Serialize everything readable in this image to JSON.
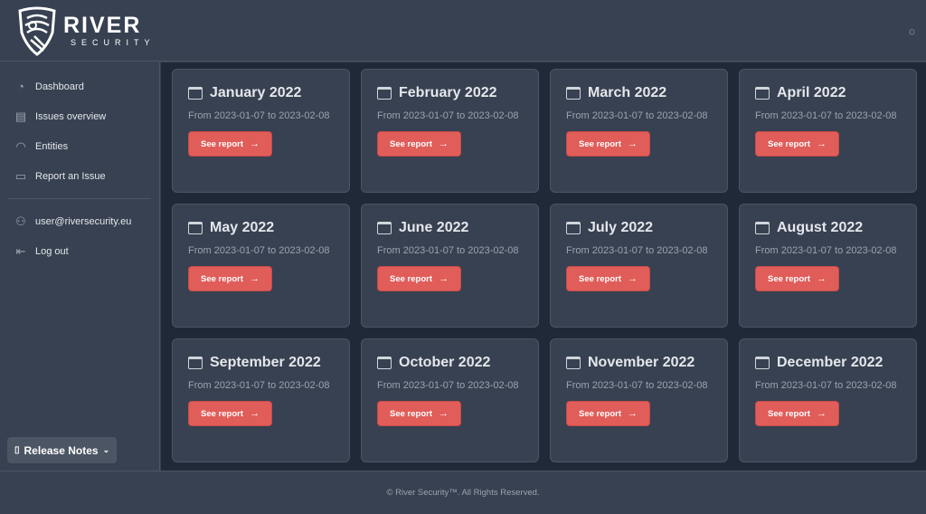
{
  "brand": {
    "name": "RIVER",
    "sub": "SECURITY"
  },
  "header": {
    "theme_icon": "sun-icon"
  },
  "sidebar": {
    "items": [
      {
        "label": "Dashboard",
        "icon": "pie-chart-icon"
      },
      {
        "label": "Issues overview",
        "icon": "document-chart-icon"
      },
      {
        "label": "Entities",
        "icon": "fingerprint-icon"
      },
      {
        "label": "Report an Issue",
        "icon": "chat-alert-icon"
      }
    ],
    "user": {
      "label": "user@riversecurity.eu",
      "icon": "user-icon"
    },
    "logout": {
      "label": "Log out",
      "icon": "logout-icon"
    },
    "release_notes": "Release Notes"
  },
  "reports": [
    {
      "title": "January 2022",
      "range": "From 2023-01-07 to 2023-02-08",
      "button": "See report"
    },
    {
      "title": "February 2022",
      "range": "From 2023-01-07 to 2023-02-08",
      "button": "See report"
    },
    {
      "title": "March 2022",
      "range": "From 2023-01-07 to 2023-02-08",
      "button": "See report"
    },
    {
      "title": "April 2022",
      "range": "From 2023-01-07 to 2023-02-08",
      "button": "See report"
    },
    {
      "title": "May 2022",
      "range": "From 2023-01-07 to 2023-02-08",
      "button": "See report"
    },
    {
      "title": "June 2022",
      "range": "From 2023-01-07 to 2023-02-08",
      "button": "See report"
    },
    {
      "title": "July 2022",
      "range": "From 2023-01-07 to 2023-02-08",
      "button": "See report"
    },
    {
      "title": "August 2022",
      "range": "From 2023-01-07 to 2023-02-08",
      "button": "See report"
    },
    {
      "title": "September 2022",
      "range": "From 2023-01-07 to 2023-02-08",
      "button": "See report"
    },
    {
      "title": "October 2022",
      "range": "From 2023-01-07 to 2023-02-08",
      "button": "See report"
    },
    {
      "title": "November 2022",
      "range": "From 2023-01-07 to 2023-02-08",
      "button": "See report"
    },
    {
      "title": "December 2022",
      "range": "From 2023-01-07 to 2023-02-08",
      "button": "See report"
    }
  ],
  "footer": "© River Security™. All Rights Reserved.",
  "colors": {
    "accent": "#e05d59",
    "background": "#1f2937",
    "surface": "#374151"
  }
}
